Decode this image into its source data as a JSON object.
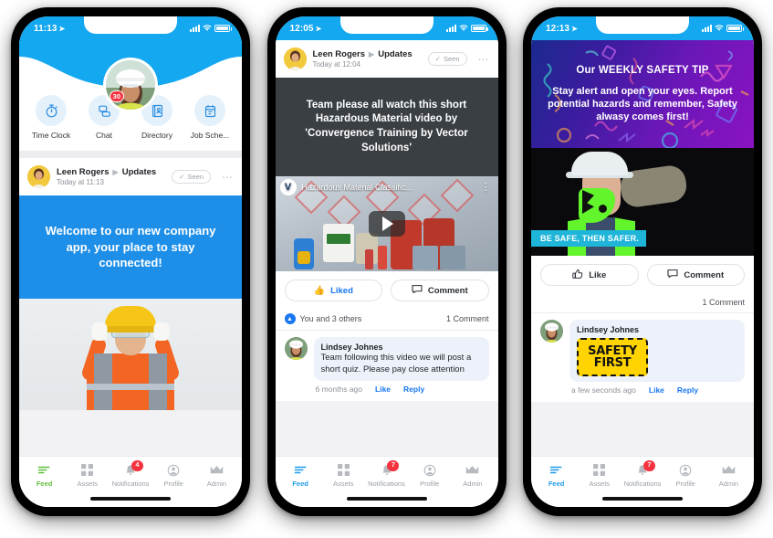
{
  "phones": [
    {
      "id": "phone-1",
      "status": {
        "time": "11:13",
        "location_icon": "location-arrow-icon",
        "signal_icon": "cellular-signal-icon",
        "wifi_icon": "wifi-icon",
        "battery_icon": "battery-icon"
      },
      "header": {
        "avatar_alt": "woman-in-white-hardhat-avatar"
      },
      "quick_actions": [
        {
          "label": "Time Clock",
          "icon": "stopwatch-icon",
          "badge": ""
        },
        {
          "label": "Chat",
          "icon": "chat-bubbles-icon",
          "badge": "30"
        },
        {
          "label": "Directory",
          "icon": "address-book-icon",
          "badge": ""
        },
        {
          "label": "Job Sche...",
          "icon": "clipboard-icon",
          "badge": ""
        }
      ],
      "post": {
        "author": "Leen Rogers",
        "channel": "Updates",
        "timestamp": "Today at 11:13",
        "seen_label": "Seen",
        "more_icon": "more-options-icon",
        "banner_text": "Welcome to our new company app, your place to stay connected!",
        "photo_alt": "construction-worker-wearing-yellow-hardhat-and-orange-vest"
      },
      "tabs": [
        {
          "label": "Feed",
          "icon": "feed-icon",
          "active": true,
          "accent": "#5FBF3F",
          "badge": ""
        },
        {
          "label": "Assets",
          "icon": "grid-icon",
          "active": false,
          "badge": ""
        },
        {
          "label": "Notifications",
          "icon": "bell-icon",
          "active": false,
          "badge": "4"
        },
        {
          "label": "Profile",
          "icon": "person-icon",
          "active": false,
          "badge": ""
        },
        {
          "label": "Admin",
          "icon": "crown-icon",
          "active": false,
          "badge": ""
        }
      ]
    },
    {
      "id": "phone-2",
      "status": {
        "time": "12:05",
        "location_icon": "location-arrow-icon",
        "signal_icon": "cellular-signal-icon",
        "wifi_icon": "wifi-icon",
        "battery_icon": "battery-icon"
      },
      "post": {
        "author": "Leen Rogers",
        "channel": "Updates",
        "timestamp": "Today at 12:04",
        "seen_label": "Seen",
        "more_icon": "more-options-icon",
        "banner_text": "Team please all watch this short Hazardous Material video by 'Convergence Training by Vector Solutions'",
        "video_title": "Hazardous Material Classific...",
        "video_logo": "vector-solutions-logo-icon",
        "video_kebab": "video-options-icon",
        "play_icon": "play-button-icon",
        "photo_alt": "hazardous-chemical-containers-and-ghs-pictograms"
      },
      "actions": {
        "like_label": "Liked",
        "like_icon": "thumbs-up-icon",
        "comment_label": "Comment",
        "comment_icon": "comment-bubble-icon",
        "liked": true
      },
      "meta": {
        "reactions": "You and 3 others",
        "reaction_icon": "thumbs-up-filled-icon",
        "comment_count": "1 Comment"
      },
      "comment": {
        "avatar_alt": "woman-in-white-hardhat-avatar",
        "name": "Lindsey Johnes",
        "text": "Team following this video we will post a short quiz. Please pay close attention",
        "time": "6 months ago",
        "like_label": "Like",
        "reply_label": "Reply"
      },
      "tabs": [
        {
          "label": "Feed",
          "icon": "feed-icon",
          "active": true,
          "accent": "#1E9BE8",
          "badge": ""
        },
        {
          "label": "Assets",
          "icon": "grid-icon",
          "active": false,
          "badge": ""
        },
        {
          "label": "Notifications",
          "icon": "bell-icon",
          "active": false,
          "badge": "7"
        },
        {
          "label": "Profile",
          "icon": "person-icon",
          "active": false,
          "badge": ""
        },
        {
          "label": "Admin",
          "icon": "crown-icon",
          "active": false,
          "badge": ""
        }
      ]
    },
    {
      "id": "phone-3",
      "status": {
        "time": "12:13",
        "location_icon": "location-arrow-icon",
        "signal_icon": "cellular-signal-icon",
        "wifi_icon": "wifi-icon",
        "battery_icon": "battery-icon"
      },
      "post": {
        "banner_title": "Our WEEKLY SAFETY TIP",
        "banner_text": "Stay alert and open your eyes. Report potential hazards and remember, Safety alwasy comes first!",
        "photo_alt": "worker-in-hardhat-wearing-green-respirator-mask",
        "photo_caption": "BE SAFE, THEN SAFER."
      },
      "actions": {
        "like_label": "Like",
        "like_icon": "thumbs-up-icon",
        "comment_label": "Comment",
        "comment_icon": "comment-bubble-icon",
        "liked": false
      },
      "meta": {
        "comment_count": "1 Comment"
      },
      "comment": {
        "avatar_alt": "woman-in-white-hardhat-avatar",
        "name": "Lindsey Johnes",
        "sticker_line1": "SAFETY",
        "sticker_line2": "FIRST",
        "time": "a few seconds ago",
        "like_label": "Like",
        "reply_label": "Reply"
      },
      "tabs": [
        {
          "label": "Feed",
          "icon": "feed-icon",
          "active": true,
          "accent": "#1E9BE8",
          "badge": ""
        },
        {
          "label": "Assets",
          "icon": "grid-icon",
          "active": false,
          "badge": ""
        },
        {
          "label": "Notifications",
          "icon": "bell-icon",
          "active": false,
          "badge": "7"
        },
        {
          "label": "Profile",
          "icon": "person-icon",
          "active": false,
          "badge": ""
        },
        {
          "label": "Admin",
          "icon": "crown-icon",
          "active": false,
          "badge": ""
        }
      ]
    }
  ],
  "colors": {
    "brand_blue": "#14A8F0",
    "post_blue": "#1E8FE8",
    "link_blue": "#1877F2",
    "badge_red": "#F5333F",
    "feed_green": "#5FBF3F",
    "dark_panel": "#3A3F44",
    "caption_teal": "#1FB5D8",
    "sticker_yellow": "#FFD400",
    "mask_green": "#63F52C"
  }
}
